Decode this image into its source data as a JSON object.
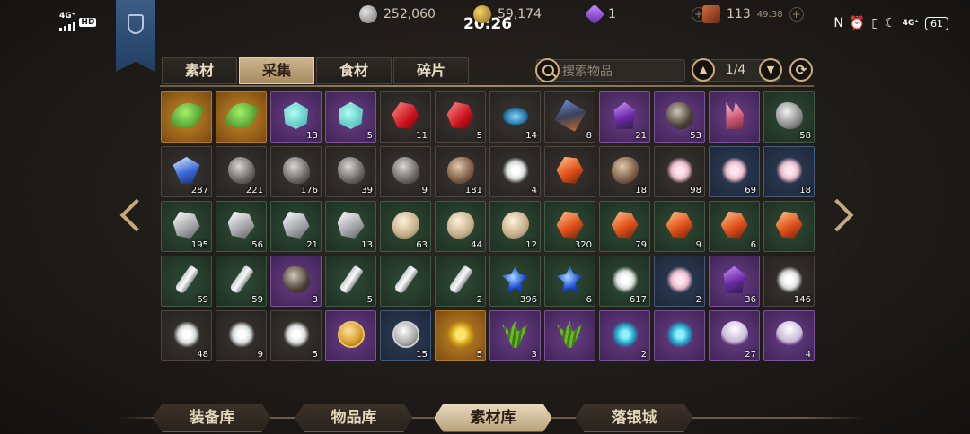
{
  "status_bar": {
    "network": "4G⁺",
    "hd": "HD",
    "time": "20:26",
    "right_network": "4G⁺",
    "battery": "61"
  },
  "currencies": [
    {
      "name": "silver-coin",
      "value": "252,060",
      "icon_color": "#bdbdbd"
    },
    {
      "name": "gold-coin",
      "value": "59,174",
      "icon_color": "#d9a935"
    },
    {
      "name": "purple-gem",
      "value": "1",
      "icon_color": "#9a5ee6"
    },
    {
      "name": "stamina-book",
      "value": "113",
      "sub": "49:38",
      "icon_color": "#b4532c"
    }
  ],
  "tabs": [
    {
      "label": "素材",
      "active": false
    },
    {
      "label": "采集",
      "active": true
    },
    {
      "label": "食材",
      "active": false
    },
    {
      "label": "碎片",
      "active": false
    }
  ],
  "search": {
    "placeholder": "搜索物品"
  },
  "pager": {
    "text": "1/4"
  },
  "rarity_colors": {
    "orange": "#a8741f",
    "purple": "#6d3f8c",
    "green": "#2f4a36",
    "blue": "#2e3f5a",
    "gray": "#37322e"
  },
  "items": [
    {
      "icon": "green-leaf-icon",
      "shape": "leaf",
      "rarity": "orange",
      "count": ""
    },
    {
      "icon": "green-leaf-icon",
      "shape": "leaf",
      "rarity": "orange",
      "count": ""
    },
    {
      "icon": "rune-gem-icon",
      "shape": "runegem",
      "rarity": "purple",
      "count": "13"
    },
    {
      "icon": "rune-gem-icon",
      "shape": "runegem",
      "rarity": "purple",
      "count": "5"
    },
    {
      "icon": "ruby-icon",
      "shape": "ruby",
      "rarity": "gray",
      "count": "11"
    },
    {
      "icon": "ruby-icon",
      "shape": "ruby",
      "rarity": "gray",
      "count": "5"
    },
    {
      "icon": "blue-pool-icon",
      "shape": "bluepool",
      "rarity": "gray",
      "count": "14"
    },
    {
      "icon": "crystal-cube-icon",
      "shape": "cube",
      "rarity": "gray",
      "count": "8"
    },
    {
      "icon": "amethyst-icon",
      "shape": "amethyst",
      "rarity": "purple",
      "count": "21"
    },
    {
      "icon": "dark-ore-icon",
      "shape": "darkore",
      "rarity": "purple",
      "count": "53"
    },
    {
      "icon": "pink-crystal-icon",
      "shape": "pinkcrystal",
      "rarity": "purple",
      "count": ""
    },
    {
      "icon": "silver-ore-icon",
      "shape": "silverore",
      "rarity": "green",
      "count": "58"
    },
    {
      "icon": "blue-crystal-icon",
      "shape": "bluecrystal",
      "rarity": "gray",
      "count": "287"
    },
    {
      "icon": "gray-ore-icon",
      "shape": "grayore",
      "rarity": "gray",
      "count": "221"
    },
    {
      "icon": "gray-ore-icon",
      "shape": "grayore",
      "rarity": "gray",
      "count": "176"
    },
    {
      "icon": "gray-ore-icon",
      "shape": "grayore",
      "rarity": "gray",
      "count": "39"
    },
    {
      "icon": "gray-ore-icon",
      "shape": "grayore",
      "rarity": "gray",
      "count": "9"
    },
    {
      "icon": "brown-ore-icon",
      "shape": "brownore",
      "rarity": "gray",
      "count": "181"
    },
    {
      "icon": "white-salt-icon",
      "shape": "saltwhite",
      "rarity": "gray",
      "count": "4"
    },
    {
      "icon": "amber-icon",
      "shape": "amber",
      "rarity": "gray",
      "count": ""
    },
    {
      "icon": "brown-ore-icon",
      "shape": "brownore",
      "rarity": "gray",
      "count": "18"
    },
    {
      "icon": "pink-salt-icon",
      "shape": "saltpink",
      "rarity": "gray",
      "count": "98"
    },
    {
      "icon": "pink-salt-icon",
      "shape": "saltpink",
      "rarity": "blue",
      "count": "69"
    },
    {
      "icon": "pink-salt-icon",
      "shape": "saltpink",
      "rarity": "blue",
      "count": "18"
    },
    {
      "icon": "quartz-icon",
      "shape": "quartz",
      "rarity": "green",
      "count": "195"
    },
    {
      "icon": "quartz-icon",
      "shape": "quartz",
      "rarity": "green",
      "count": "56"
    },
    {
      "icon": "quartz-icon",
      "shape": "quartz",
      "rarity": "green",
      "count": "21"
    },
    {
      "icon": "quartz-icon",
      "shape": "quartz",
      "rarity": "green",
      "count": "13"
    },
    {
      "icon": "beige-rock-icon",
      "shape": "beigerock",
      "rarity": "green",
      "count": "63"
    },
    {
      "icon": "beige-rock-icon",
      "shape": "beigerock",
      "rarity": "green",
      "count": "44"
    },
    {
      "icon": "beige-rock-icon",
      "shape": "beigerock",
      "rarity": "green",
      "count": "12"
    },
    {
      "icon": "amber-icon",
      "shape": "amber",
      "rarity": "green",
      "count": "320"
    },
    {
      "icon": "amber-icon",
      "shape": "amber",
      "rarity": "green",
      "count": "79"
    },
    {
      "icon": "amber-icon",
      "shape": "amber",
      "rarity": "green",
      "count": "9"
    },
    {
      "icon": "amber-icon",
      "shape": "amber",
      "rarity": "green",
      "count": "6"
    },
    {
      "icon": "amber-icon",
      "shape": "amber",
      "rarity": "green",
      "count": ""
    },
    {
      "icon": "bottle-icon",
      "shape": "bottle",
      "rarity": "green",
      "count": "69"
    },
    {
      "icon": "bottle-icon",
      "shape": "bottle",
      "rarity": "green",
      "count": "59"
    },
    {
      "icon": "dark-ore-icon",
      "shape": "darkore",
      "rarity": "purple",
      "count": "3"
    },
    {
      "icon": "bottle-icon",
      "shape": "bottle",
      "rarity": "green",
      "count": "5"
    },
    {
      "icon": "bottle-icon",
      "shape": "bottle",
      "rarity": "green",
      "count": ""
    },
    {
      "icon": "bottle-icon",
      "shape": "bottle",
      "rarity": "green",
      "count": "2"
    },
    {
      "icon": "cornflower-icon",
      "shape": "cornflower",
      "rarity": "green",
      "count": "396"
    },
    {
      "icon": "cornflower-icon",
      "shape": "cornflower",
      "rarity": "green",
      "count": "6"
    },
    {
      "icon": "white-salt-icon",
      "shape": "saltwhite",
      "rarity": "green",
      "count": "617"
    },
    {
      "icon": "pink-salt-icon",
      "shape": "saltpink",
      "rarity": "blue",
      "count": "2"
    },
    {
      "icon": "amethyst-icon",
      "shape": "amethyst",
      "rarity": "purple",
      "count": "36"
    },
    {
      "icon": "white-salt-icon",
      "shape": "saltwhite",
      "rarity": "gray",
      "count": "146"
    },
    {
      "icon": "white-salt-icon",
      "shape": "saltwhite",
      "rarity": "gray",
      "count": "48"
    },
    {
      "icon": "white-salt-icon",
      "shape": "saltwhite",
      "rarity": "gray",
      "count": "9"
    },
    {
      "icon": "white-salt-icon",
      "shape": "saltwhite",
      "rarity": "gray",
      "count": "5"
    },
    {
      "icon": "gold-coin-icon",
      "shape": "coin",
      "rarity": "purple",
      "count": ""
    },
    {
      "icon": "silver-coin-icon",
      "shape": "silvercoin",
      "rarity": "blue",
      "count": "15"
    },
    {
      "icon": "golden-herb-icon",
      "shape": "goldherb",
      "rarity": "orange",
      "count": "5"
    },
    {
      "icon": "grass-bundle-icon",
      "shape": "grass",
      "rarity": "purple",
      "count": "3"
    },
    {
      "icon": "grass-bundle-icon",
      "shape": "grass",
      "rarity": "purple",
      "count": ""
    },
    {
      "icon": "cyan-flower-icon",
      "shape": "cyanflower",
      "rarity": "purple",
      "count": "2"
    },
    {
      "icon": "cyan-flower-icon",
      "shape": "cyanflower",
      "rarity": "purple",
      "count": ""
    },
    {
      "icon": "bellflower-icon",
      "shape": "bellflower",
      "rarity": "purple",
      "count": "27"
    },
    {
      "icon": "bellflower-icon",
      "shape": "bellflower",
      "rarity": "purple",
      "count": "4"
    }
  ],
  "bottom_tabs": [
    {
      "label": "装备库",
      "active": false
    },
    {
      "label": "物品库",
      "active": false
    },
    {
      "label": "素材库",
      "active": true
    },
    {
      "label": "落银城",
      "active": false
    }
  ]
}
